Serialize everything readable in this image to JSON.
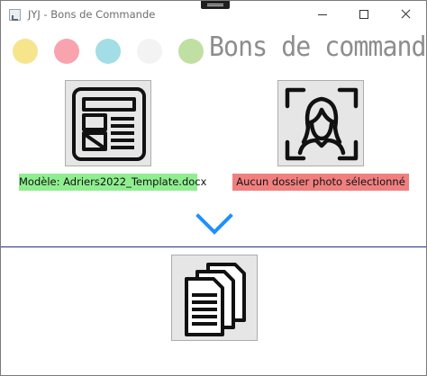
{
  "window": {
    "title": "JYJ - Bons de Commande"
  },
  "header": {
    "dots": [
      {
        "name": "yellow",
        "color": "#f6e58d"
      },
      {
        "name": "red",
        "color": "#f8a3ad"
      },
      {
        "name": "blue",
        "color": "#a3dde6"
      },
      {
        "name": "white",
        "color": "#f3f3f3"
      },
      {
        "name": "green",
        "color": "#bfe0a2"
      }
    ],
    "title": "Bons de commande"
  },
  "template": {
    "icon": "document-layout-icon",
    "label": "Modèle: Adriers2022_Template.docx",
    "label_color": "#90ee90"
  },
  "photo": {
    "icon": "face-scan-icon",
    "label": "Aucun dossier photo sélectionné",
    "label_color": "#f08080"
  },
  "arrow": {
    "icon": "chevron-down-icon",
    "color": "#1e90ff"
  },
  "generate": {
    "icon": "documents-stack-icon"
  },
  "colors": {
    "divider": "#1f2f88",
    "button_bg": "#e6e6e6"
  }
}
